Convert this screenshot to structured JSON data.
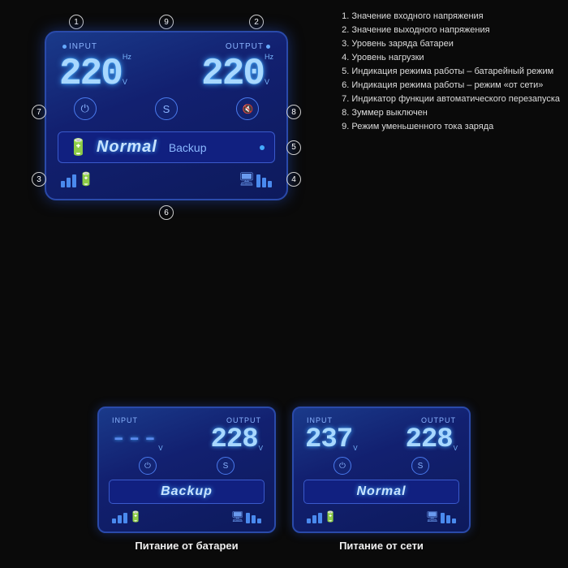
{
  "legend": {
    "items": [
      "1. Значение входного напряжения",
      "2. Значение выходного напряжения",
      "3. Уровень заряда батареи",
      "4. Уровень нагрузки",
      "5. Индикация режима работы – батарейный режим",
      "6. Индикация режима работы – режим «от сети»",
      "7. Индикатор функции автоматического перезапуска",
      "8. Зуммер выключен",
      "9. Режим уменьшенного тока заряда"
    ]
  },
  "main_display": {
    "input_label": "INPUT",
    "output_label": "OUTPUT",
    "input_voltage": "220",
    "output_voltage": "220",
    "hz_label": "Hz",
    "v_label": "V",
    "status_text": "Normal",
    "backup_text": "Backup",
    "icon_auto": "⏻",
    "icon_s": "S",
    "icon_mute": "🔕"
  },
  "callouts": {
    "c1": "1",
    "c2": "2",
    "c3": "3",
    "c4": "4",
    "c5": "5",
    "c6": "6",
    "c7": "7",
    "c8": "8",
    "c9": "9"
  },
  "bottom_left": {
    "input_label": "INPUT",
    "output_label": "OUTPUT",
    "input_voltage": "---",
    "output_voltage": "228",
    "status_text": "Backup",
    "caption": "Питание от батареи"
  },
  "bottom_right": {
    "input_label": "INPUT",
    "output_label": "OUTPUT",
    "input_voltage": "237",
    "output_voltage": "228",
    "status_text": "Normal",
    "caption": "Питание от сети"
  }
}
